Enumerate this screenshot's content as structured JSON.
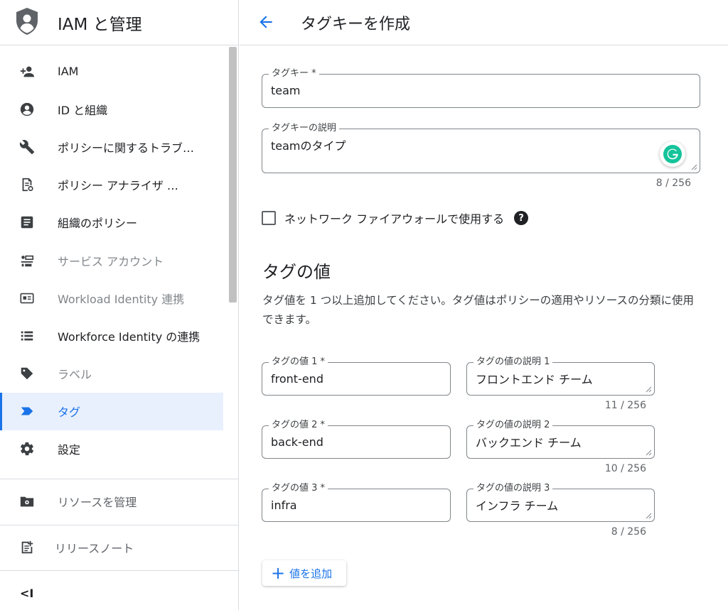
{
  "sidebar": {
    "title": "IAM と管理",
    "items": [
      {
        "label": "IAM",
        "icon": "add-person-icon"
      },
      {
        "label": "ID と組織",
        "icon": "account-circle-icon"
      },
      {
        "label": "ポリシーに関するトラブ…",
        "icon": "wrench-icon"
      },
      {
        "label": "ポリシー アナライザ …",
        "icon": "policy-analyzer-icon"
      },
      {
        "label": "組織のポリシー",
        "icon": "document-icon"
      },
      {
        "label": "サービス アカウント",
        "icon": "service-account-icon"
      },
      {
        "label": "Workload Identity 連携",
        "icon": "id-card-icon"
      },
      {
        "label": "Workforce Identity の連携",
        "icon": "list-icon"
      },
      {
        "label": "ラベル",
        "icon": "label-icon"
      },
      {
        "label": "タグ",
        "icon": "tag-icon"
      },
      {
        "label": "設定",
        "icon": "gear-icon"
      }
    ],
    "manage_resources": "リソースを管理",
    "release_notes": "リリースノート",
    "collapse": "<I"
  },
  "header": {
    "title": "タグキーを作成"
  },
  "form": {
    "tag_key": {
      "label": "タグキー *",
      "value": "team"
    },
    "tag_key_desc": {
      "label": "タグキーの説明",
      "value": "teamのタイプ",
      "counter": "8 / 256"
    },
    "firewall_checkbox": {
      "label": "ネットワーク ファイアウォールで使用する",
      "checked": false,
      "help": "?"
    }
  },
  "tag_values": {
    "title": "タグの値",
    "description": "タグ値を 1 つ以上追加してください。タグ値はポリシーの適用やリソースの分類に使用できます。",
    "rows": [
      {
        "value_label": "タグの値 1 *",
        "value": "front-end",
        "desc_label": "タグの値の説明 1",
        "desc": "フロントエンド チーム",
        "counter": "11 / 256"
      },
      {
        "value_label": "タグの値 2 *",
        "value": "back-end",
        "desc_label": "タグの値の説明 2",
        "desc": "バックエンド チーム",
        "counter": "10 / 256"
      },
      {
        "value_label": "タグの値 3 *",
        "value": "infra",
        "desc_label": "タグの値の説明 3",
        "desc": "インフラ チーム",
        "counter": "8 / 256"
      }
    ],
    "add_button": "値を追加"
  },
  "colors": {
    "accent": "#1a73e8",
    "active_bg": "#e8f0fe",
    "grammarly": "#15c39a"
  }
}
